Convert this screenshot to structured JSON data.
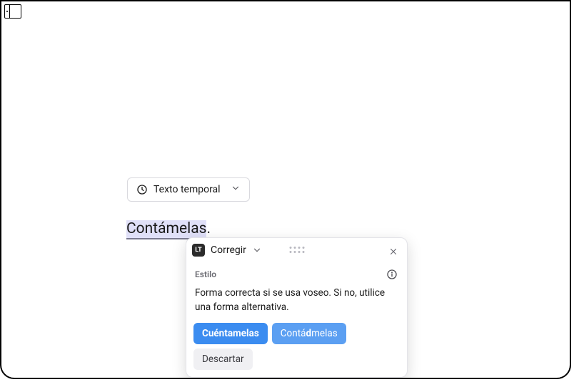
{
  "sidebar_toggle_icon": "panel-left-icon",
  "chip": {
    "icon": "clock-icon",
    "label": "Texto temporal",
    "chevron": "chevron-down-icon"
  },
  "content": {
    "highlighted_word": "Contámelas",
    "trailing_punct": "."
  },
  "popup": {
    "brand": "LT",
    "title": "Corregir",
    "title_chevron": "chevron-down-icon",
    "drag_handle": "drag-handle-icon",
    "close": "close-icon",
    "section_label": "Estilo",
    "info_icon": "info-icon",
    "explanation": "Forma correcta si se usa voseo. Si no, utilice una forma alternativa.",
    "actions": {
      "primary": "Cuéntamelas",
      "secondary_pre": "Contá",
      "secondary_bold": "d",
      "secondary_post": "melas",
      "tertiary": "Descartar"
    }
  }
}
